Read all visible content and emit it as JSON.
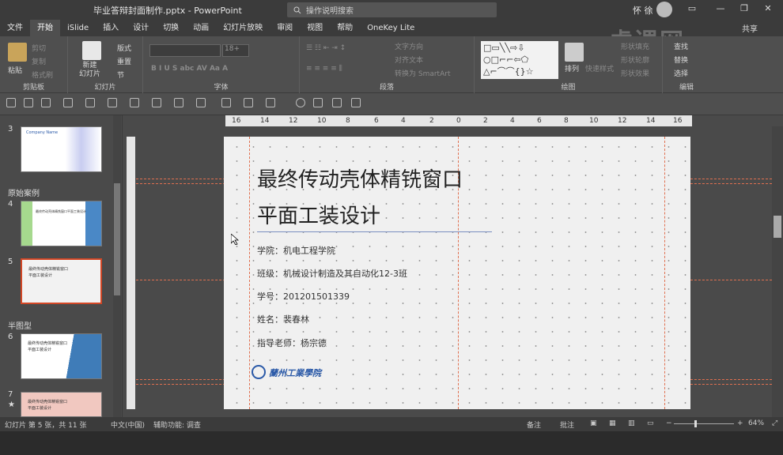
{
  "window": {
    "filename": "毕业答辩封面制作.pptx  -  PowerPoint",
    "search_placeholder": "操作说明搜索",
    "user": "怀 徐",
    "share": "共享"
  },
  "tabs": [
    "文件",
    "开始",
    "iSlide",
    "插入",
    "设计",
    "切换",
    "动画",
    "幻灯片放映",
    "审阅",
    "视图",
    "帮助",
    "OneKey Lite"
  ],
  "active_tab": "开始",
  "ribbon": {
    "clipboard": {
      "label": "剪贴板",
      "paste": "粘贴",
      "cut": "剪切",
      "copy": "复制",
      "format_painter": "格式刷"
    },
    "slides": {
      "label": "幻灯片",
      "new_slide": "新建\n幻灯片",
      "layout": "版式",
      "reset": "重置",
      "section": "节"
    },
    "font": {
      "label": "字体",
      "size": "18+"
    },
    "paragraph": {
      "label": "段落",
      "text_direction": "文字方向",
      "align_text": "对齐文本",
      "smartart": "转换为 SmartArt"
    },
    "drawing": {
      "label": "绘图",
      "arrange": "排列",
      "quick_styles": "快速样式",
      "shape_fill": "形状填充",
      "shape_outline": "形状轮廓",
      "shape_effects": "形状效果"
    },
    "editing": {
      "label": "编辑",
      "find": "查找",
      "replace": "替换",
      "select": "选择"
    }
  },
  "thumbnails": {
    "sections": [
      "原始案例",
      "半图型"
    ],
    "slides": [
      {
        "num": "3",
        "title": "Company Name"
      },
      {
        "num": "4",
        "title": "最终传动壳体精铣窗口平面工装设计"
      },
      {
        "num": "5",
        "title": "最终传动壳体精铣窗口\n平面工装设计"
      },
      {
        "num": "6",
        "title": "最终传动壳体精铣窗口\n平面工装设计"
      },
      {
        "num": "7",
        "title": "最终传动壳体精铣窗口\n平面工装设计"
      }
    ]
  },
  "ruler": [
    "16",
    "14",
    "12",
    "10",
    "8",
    "6",
    "4",
    "2",
    "0",
    "2",
    "4",
    "6",
    "8",
    "10",
    "12",
    "14",
    "16"
  ],
  "slide": {
    "title_line1": "最终传动壳体精铣窗口",
    "title_line2": "平面工装设计",
    "fields": [
      "学院：机电工程学院",
      "班级：机械设计制造及其自动化12-3班",
      "学号：201201501339",
      "姓名：裴春林",
      "指导老师：杨宗德"
    ],
    "logo_text": "蘭州工業學院"
  },
  "status": {
    "slide_info": "幻灯片 第 5 张，共 11 张",
    "language": "中文(中国)",
    "accessibility": "辅助功能: 调查",
    "notes": "备注",
    "comments": "批注",
    "zoom": "64%"
  },
  "watermark": "虎课网"
}
